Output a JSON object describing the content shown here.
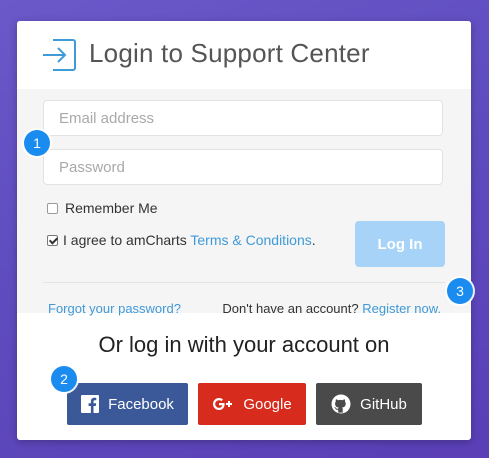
{
  "header": {
    "title": "Login to Support Center",
    "icon": "login-icon"
  },
  "form": {
    "email_placeholder": "Email address",
    "password_placeholder": "Password",
    "remember_label": "Remember Me",
    "remember_checked": false,
    "agree_prefix": "I agree to amCharts ",
    "agree_link": "Terms & Conditions",
    "agree_suffix": ".",
    "agree_checked": true,
    "login_label": "Log In",
    "forgot_label": "Forgot your password?",
    "no_account_text": "Don't have an account? ",
    "register_label": "Register now."
  },
  "social": {
    "title": "Or log in with your account on",
    "facebook_label": "Facebook",
    "google_label": "Google",
    "github_label": "GitHub"
  },
  "badges": {
    "one": "1",
    "two": "2",
    "three": "3"
  },
  "colors": {
    "accent": "#3f9ad8",
    "login_button": "#a6d3f7",
    "facebook": "#3b5998",
    "google": "#d72c1d",
    "github": "#4a4a4a",
    "badge": "#1a8cf0"
  }
}
